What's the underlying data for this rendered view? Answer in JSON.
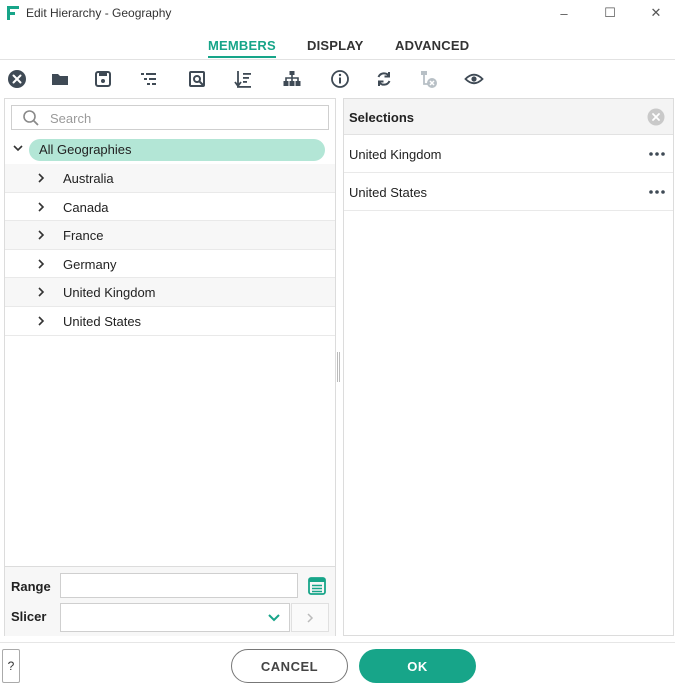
{
  "window": {
    "title": "Edit Hierarchy - Geography",
    "minimize_glyph": "–",
    "maximize_glyph": "☐",
    "close_glyph": "✕"
  },
  "tabs": [
    {
      "label": "MEMBERS",
      "active": true
    },
    {
      "label": "DISPLAY",
      "active": false
    },
    {
      "label": "ADVANCED",
      "active": false
    }
  ],
  "toolbar": {
    "icons": [
      "clear-icon",
      "folder-icon",
      "save-icon",
      "levels-icon",
      "find-icon",
      "sort-icon",
      "hierarchy-icon",
      "info-icon",
      "refresh-icon",
      "filter-remove-icon",
      "eye-icon"
    ]
  },
  "search": {
    "placeholder": "Search",
    "value": ""
  },
  "tree": {
    "root_label": "All Geographies",
    "items": [
      {
        "label": "Australia"
      },
      {
        "label": "Canada"
      },
      {
        "label": "France"
      },
      {
        "label": "Germany"
      },
      {
        "label": "United Kingdom"
      },
      {
        "label": "United States"
      }
    ]
  },
  "range": {
    "label": "Range",
    "value": ""
  },
  "slicer": {
    "label": "Slicer",
    "value": ""
  },
  "selections": {
    "title": "Selections",
    "items": [
      {
        "label": "United Kingdom"
      },
      {
        "label": "United States"
      }
    ]
  },
  "footer": {
    "help_label": "?",
    "cancel_label": "CANCEL",
    "ok_label": "OK"
  },
  "colors": {
    "accent": "#17a589",
    "root_highlight": "#b3e6d6",
    "icon_dark": "#3f4a55"
  }
}
